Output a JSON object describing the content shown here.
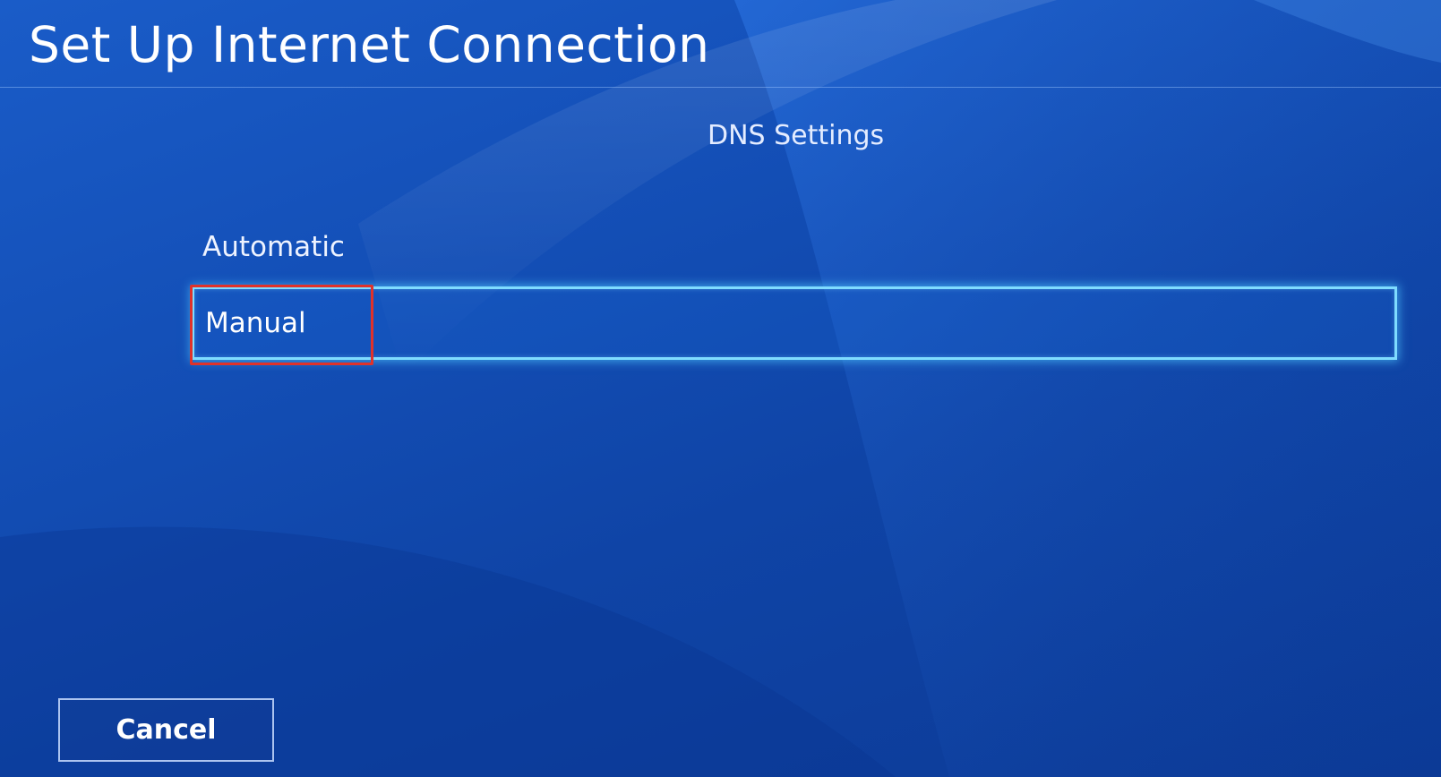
{
  "header": {
    "title": "Set Up Internet Connection"
  },
  "section": {
    "title": "DNS Settings"
  },
  "options": [
    {
      "label": "Automatic",
      "selected": false
    },
    {
      "label": "Manual",
      "selected": true
    }
  ],
  "footer": {
    "cancel_label": "Cancel"
  },
  "colors": {
    "background": "#1450b8",
    "focus_border": "#7fdcff",
    "annotation": "#e0322a"
  }
}
